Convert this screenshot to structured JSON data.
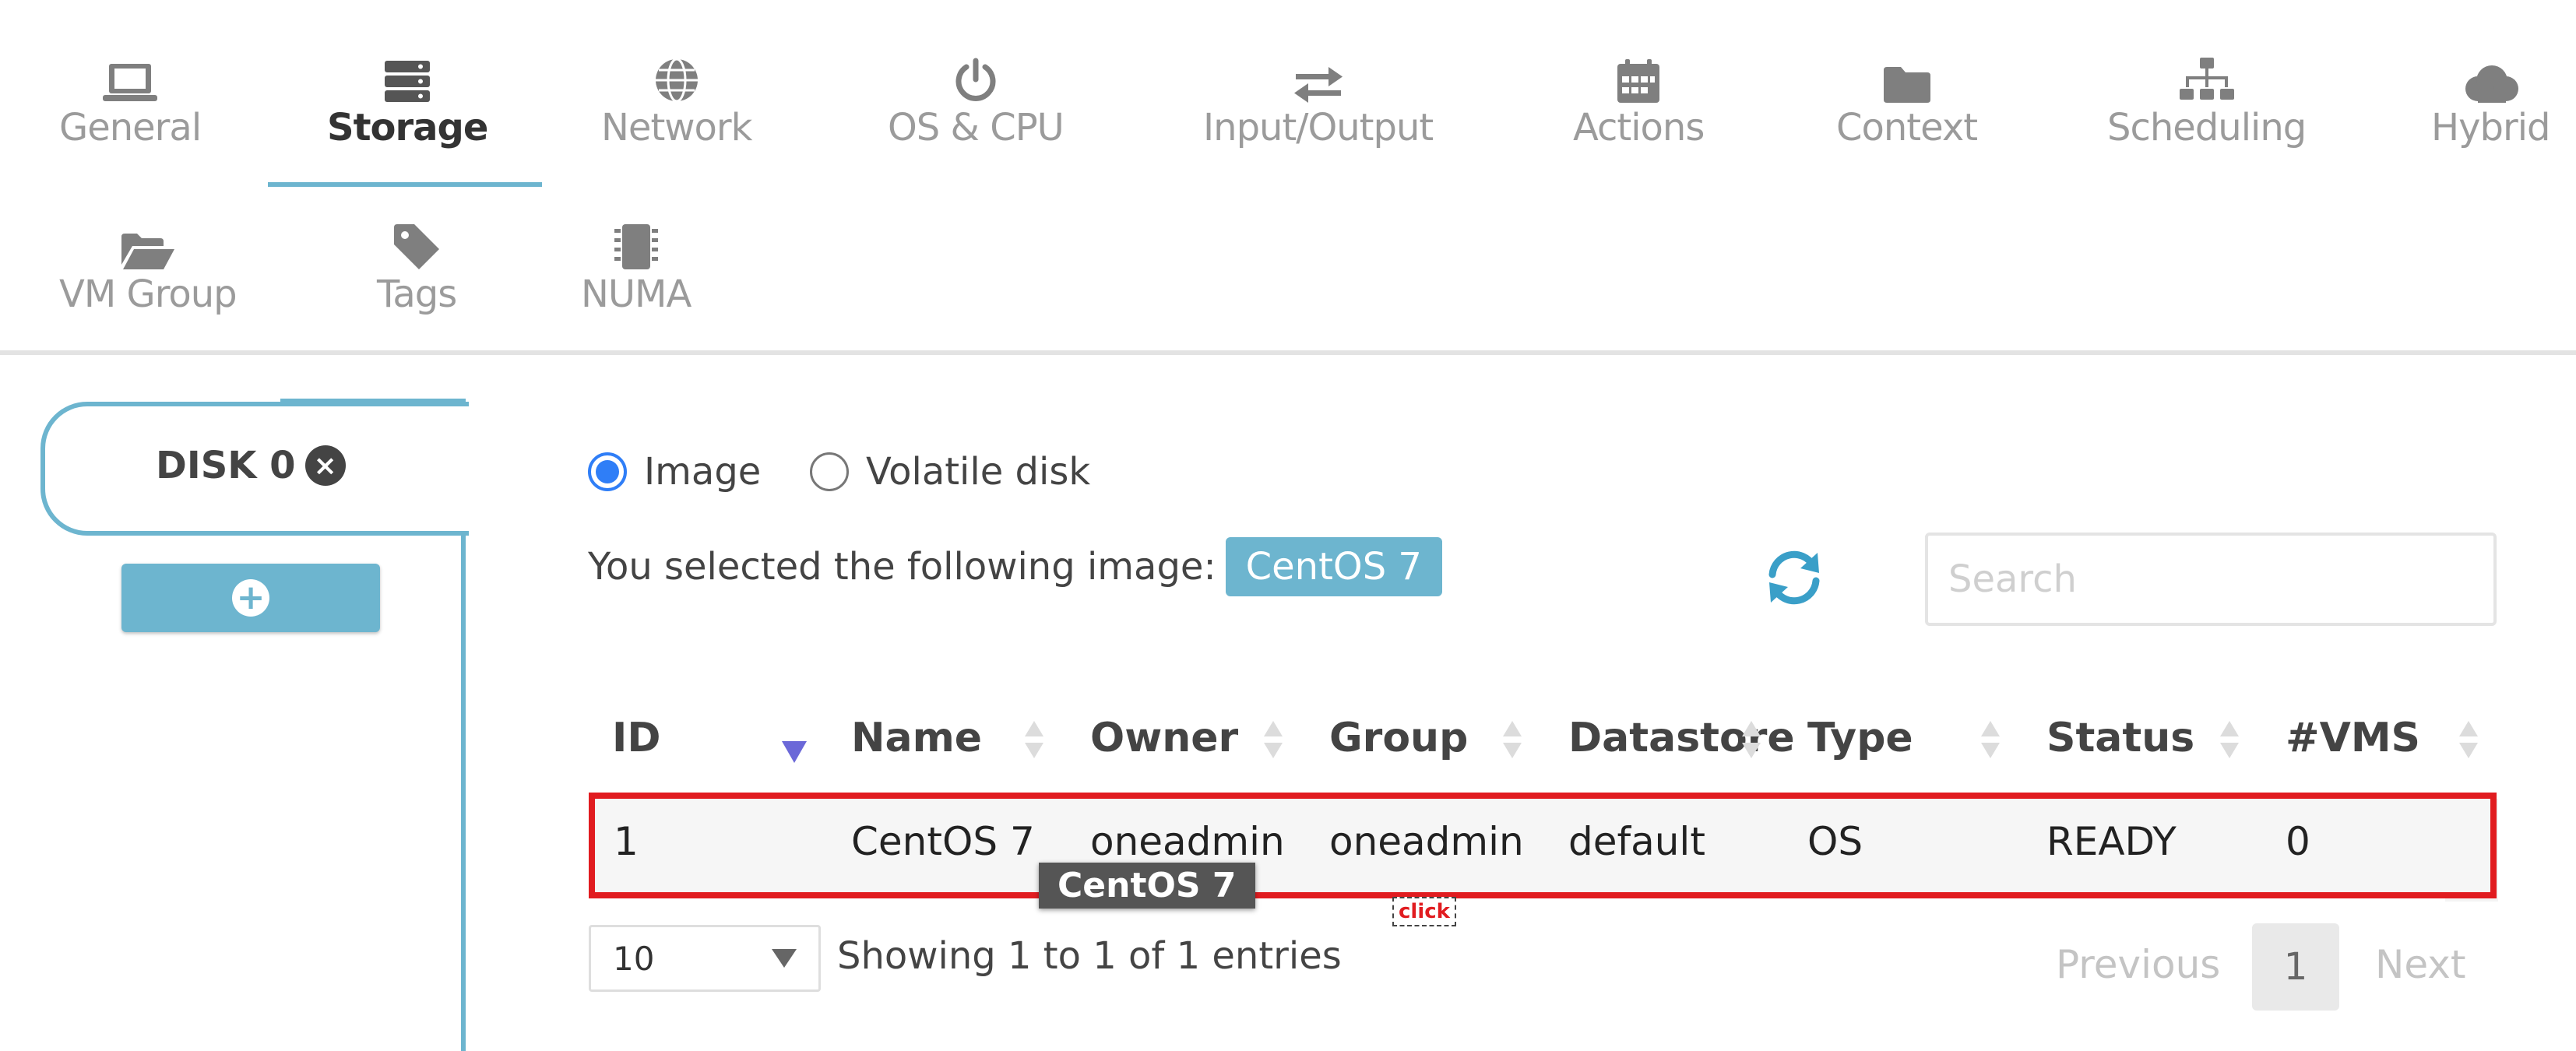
{
  "tabs": [
    {
      "label": "General",
      "icon": "laptop-icon"
    },
    {
      "label": "Storage",
      "icon": "server-icon"
    },
    {
      "label": "Network",
      "icon": "globe-icon"
    },
    {
      "label": "OS & CPU",
      "icon": "power-icon"
    },
    {
      "label": "Input/Output",
      "icon": "exchange-arrows-icon"
    },
    {
      "label": "Actions",
      "icon": "calendar-icon"
    },
    {
      "label": "Context",
      "icon": "folder-icon"
    },
    {
      "label": "Scheduling",
      "icon": "sitemap-icon"
    },
    {
      "label": "Hybrid",
      "icon": "cloud-icon"
    },
    {
      "label": "VM Group",
      "icon": "folder-open-icon"
    },
    {
      "label": "Tags",
      "icon": "tag-icon"
    },
    {
      "label": "NUMA",
      "icon": "microchip-icon"
    }
  ],
  "active_tab": "Storage",
  "disk_panel": {
    "disk_label": "DISK 0",
    "close_icon": "times-circle-icon",
    "add_icon": "plus-circle-icon"
  },
  "disk_type": {
    "options": [
      "Image",
      "Volatile disk"
    ],
    "selected": "Image"
  },
  "selection": {
    "prefix": "You selected the following image:",
    "image": "CentOS 7"
  },
  "refresh_icon": "refresh-icon",
  "search": {
    "placeholder": "Search",
    "value": ""
  },
  "table": {
    "columns": [
      "ID",
      "Name",
      "Owner",
      "Group",
      "Datastore",
      "Type",
      "Status",
      "#VMS"
    ],
    "sorted_column": "ID",
    "sort_direction": "descending",
    "rows": [
      {
        "id": "1",
        "name": "CentOS 7",
        "owner": "oneadmin",
        "group": "oneadmin",
        "datastore": "default",
        "type": "OS",
        "status": "READY",
        "vms": "0"
      }
    ],
    "tooltip": "CentOS 7"
  },
  "click_marker": "click",
  "footer": {
    "page_size": "10",
    "showing": "Showing 1 to 1 of 1 entries",
    "prev": "Previous",
    "current_page": "1",
    "next": "Next"
  },
  "colors": {
    "accent": "#6db5cf",
    "radio_selected": "#2f7ef7",
    "highlight_border": "#e11c20",
    "sort_indicator": "#6b68d8"
  }
}
